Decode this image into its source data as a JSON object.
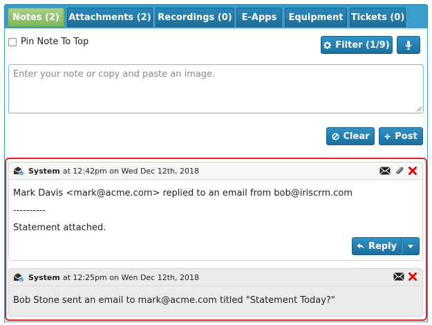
{
  "tabs": [
    {
      "label": "Notes (2)",
      "active": true
    },
    {
      "label": "Attachments (2)",
      "active": false
    },
    {
      "label": "Recordings (0)",
      "active": false
    },
    {
      "label": "E-Apps",
      "active": false
    },
    {
      "label": "Equipment",
      "active": false
    },
    {
      "label": "Tickets (0)",
      "active": false
    }
  ],
  "pin": {
    "label": "Pin Note To Top",
    "checked": false
  },
  "toolbar": {
    "filter_label": "Filter (1/9)"
  },
  "note_input": {
    "placeholder": "Enter your note or copy and paste an image."
  },
  "actions": {
    "clear_label": "Clear",
    "post_label": "Post"
  },
  "notes": [
    {
      "author": "System",
      "meta": "at 12:42pm on Wed Dec 12th, 2018",
      "lines": [
        "Mark Davis <mark@acme.com> replied to an email from bob@iriscrm.com",
        "----------",
        "Statement attached."
      ],
      "reply_label": "Reply"
    },
    {
      "author": "System",
      "meta": "at 12:25pm on Wen Dec 12th, 2018",
      "lines": [
        "Bob Stone sent an email to mark@acme.com titled \"Statement Today?\""
      ]
    }
  ],
  "colors": {
    "tab_bar": "#3a9ccb",
    "tab_active": "#8cc063",
    "button": "#2680b3",
    "highlight_border": "#e02424",
    "delete_icon": "#e00000"
  }
}
